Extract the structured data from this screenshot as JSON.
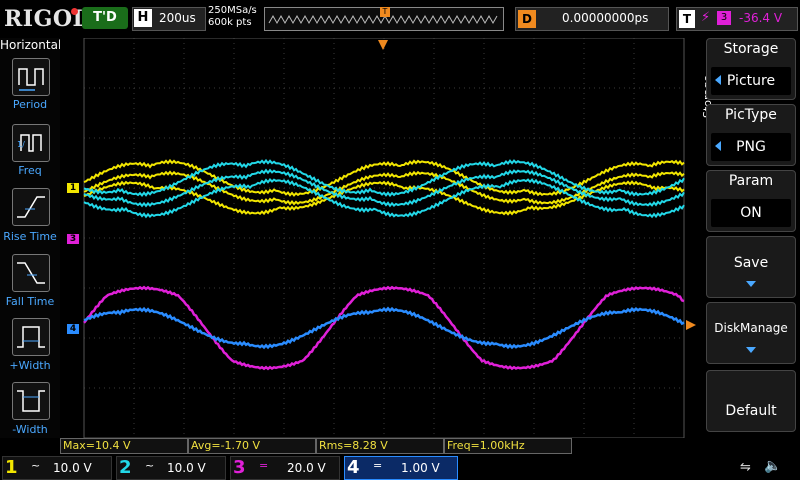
{
  "brand": "RIGOL",
  "run_status": "T'D",
  "horizontal": {
    "tag": "H",
    "timebase": "200us",
    "sample_rate": "250MSa/s",
    "mem_depth": "600k pts"
  },
  "delay": {
    "tag": "D",
    "value": "0.00000000ps"
  },
  "trigger": {
    "tag": "T",
    "edge_symbol": "⚡",
    "source": "3",
    "level": "-36.4 V"
  },
  "left_panel": {
    "title": "Horizontal",
    "items": [
      {
        "label": "Period"
      },
      {
        "label": "Freq"
      },
      {
        "label": "Rise Time"
      },
      {
        "label": "Fall Time"
      },
      {
        "label": "+Width"
      },
      {
        "label": "-Width"
      }
    ]
  },
  "right_panel": {
    "side_label": "Storage",
    "title": "Storage",
    "items": [
      {
        "label": "Storage",
        "value": ""
      },
      {
        "label": "",
        "value": "Picture"
      },
      {
        "label": "PicType",
        "value": "PNG"
      },
      {
        "label": "Param",
        "value": "ON"
      },
      {
        "label": "Save",
        "value": ""
      },
      {
        "label": "DiskManage",
        "value": ""
      },
      {
        "label": "Default",
        "value": ""
      }
    ]
  },
  "channel_markers": [
    "1",
    "3",
    "4"
  ],
  "measurements": [
    {
      "label": "Max=10.4 V"
    },
    {
      "label": "Avg=-1.70 V"
    },
    {
      "label": "Rms=8.28 V"
    },
    {
      "label": "Freq=1.00kHz"
    }
  ],
  "channels": [
    {
      "num": "1",
      "coupling": "~",
      "scale": "10.0 V",
      "color": "#f2e600"
    },
    {
      "num": "2",
      "coupling": "~",
      "scale": "10.0 V",
      "color": "#22d8e8"
    },
    {
      "num": "3",
      "coupling": "=",
      "scale": "20.0 V",
      "color": "#e020d8"
    },
    {
      "num": "4",
      "coupling": "=",
      "scale": "1.00 V",
      "color": "#2a8cff"
    }
  ],
  "colors": {
    "ch1": "#f2e600",
    "ch2": "#22d8e8",
    "ch3": "#e020d8",
    "ch4": "#2a8cff",
    "trigger": "#f08a1f"
  }
}
